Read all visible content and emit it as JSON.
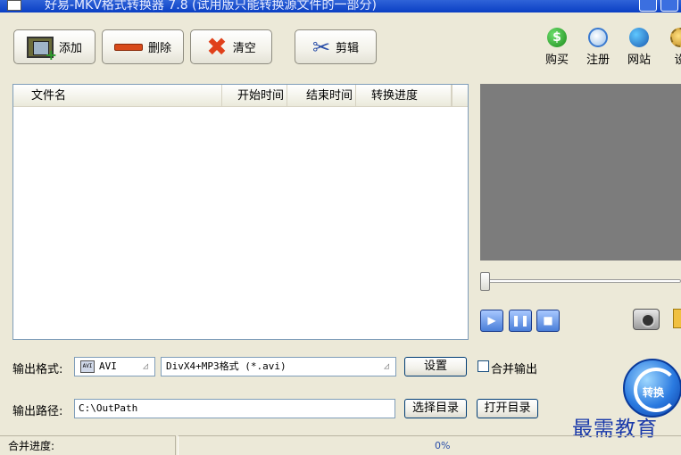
{
  "window": {
    "title": "好易-MKV格式转换器 7.8 (试用版只能转换源文件的一部分)"
  },
  "toolbar": {
    "add_label": "添加",
    "delete_label": "删除",
    "clear_label": "清空",
    "clip_label": "剪辑"
  },
  "top_right": {
    "buy": "购买",
    "register": "注册",
    "website": "网站",
    "settings": "设"
  },
  "file_list": {
    "columns": [
      "文件名",
      "开始时间",
      "结束时间",
      "转换进度"
    ],
    "rows": []
  },
  "player": {
    "seek_position": 0
  },
  "output": {
    "format_label": "输出格式:",
    "format_value": "AVI",
    "format_icon_text": "AVI",
    "profile_value": "DivX4+MP3格式 (*.avi)",
    "settings_button": "设置",
    "merge_label": "合并输出",
    "merge_checked": false,
    "path_label": "输出路径:",
    "path_value": "C:\\OutPath",
    "choose_dir_button": "选择目录",
    "open_dir_button": "打开目录",
    "convert_button": "转换"
  },
  "watermark": "最需教育",
  "status": {
    "merge_progress_label": "合并进度:",
    "progress_text": "0%",
    "progress_value": 0
  },
  "colors": {
    "title_bar": "#0a3fc4",
    "preview_bg": "#7c7c7c",
    "window_bg": "#ece9d8",
    "watermark": "#1a3aaa"
  }
}
